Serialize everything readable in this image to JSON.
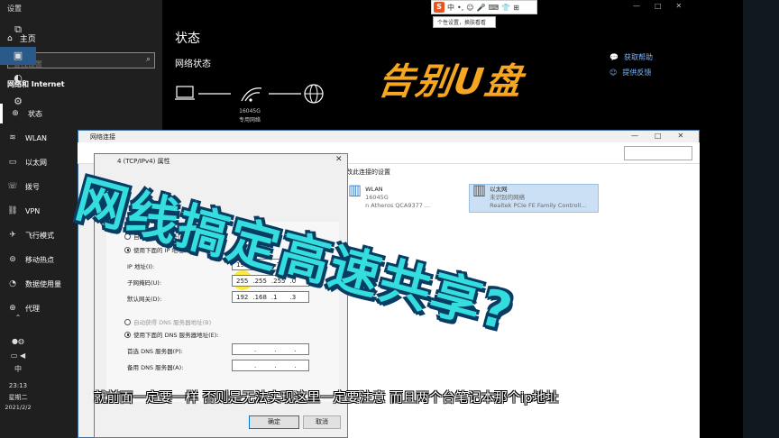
{
  "window": {
    "title": "设置"
  },
  "sidebar": {
    "home_label": "主页",
    "search_placeholder": "查找设置",
    "section_title": "网络和 Internet",
    "items": [
      {
        "label": "状态",
        "icon": "globe-icon",
        "active": true
      },
      {
        "label": "WLAN",
        "icon": "wifi-icon",
        "active": false
      },
      {
        "label": "以太网",
        "icon": "ethernet-icon",
        "active": false
      },
      {
        "label": "拨号",
        "icon": "dialup-icon",
        "active": false
      },
      {
        "label": "VPN",
        "icon": "vpn-icon",
        "active": false
      },
      {
        "label": "飞行模式",
        "icon": "airplane-icon",
        "active": false
      },
      {
        "label": "移动热点",
        "icon": "hotspot-icon",
        "active": false
      },
      {
        "label": "数据使用量",
        "icon": "data-usage-icon",
        "active": false
      },
      {
        "label": "代理",
        "icon": "proxy-icon",
        "active": false
      }
    ]
  },
  "main": {
    "heading": "状态",
    "subheading": "网络状态",
    "network_ssid": "16045G",
    "network_type": "专用网络",
    "help_links": [
      "获取帮助",
      "提供反馈"
    ]
  },
  "ime": {
    "mode": "中",
    "tooltip": "个性设置，换肤看看"
  },
  "overlay": {
    "headline": "告别U盘",
    "big_title": "网线搞定高速共享?",
    "subtitle": "就前面一定要一样 否则是无法实现这里一定要注意 而且两个台笔记本那个ip地址"
  },
  "net_window": {
    "title": "网络连接",
    "config_text": "改此连接的设置",
    "adapters": [
      {
        "name": "WLAN",
        "line2": "16045G",
        "line3": "n Atheros QCA9377 ..."
      },
      {
        "name": "以太网",
        "line2": "未识别的网络",
        "line3": "Realtek PCIe FE Family Controll..."
      }
    ]
  },
  "dialog": {
    "title": "4 (TCP/IPv4) 属性",
    "auto_ip": "自动获得 IP 地址(O)",
    "manual_ip": "使用下面的 IP 地址(S):",
    "ip_label": "IP 地址(I):",
    "ip_value": [
      "192",
      "168",
      "1",
      "2"
    ],
    "mask_label": "子网掩码(U):",
    "mask_value": [
      "255",
      "255",
      "255",
      "0"
    ],
    "gw_label": "默认网关(D):",
    "gw_value": [
      "192",
      "168",
      "1",
      "3"
    ],
    "auto_dns": "自动获得 DNS 服务器地址(B)",
    "manual_dns": "使用下面的 DNS 服务器地址(E):",
    "dns1_label": "首选 DNS 服务器(P):",
    "dns2_label": "备用 DNS 服务器(A):",
    "ok": "确定",
    "cancel": "取消"
  },
  "taskbar": {
    "ime": "中",
    "time": "23:13",
    "weekday": "星期二",
    "date": "2021/2/2"
  }
}
